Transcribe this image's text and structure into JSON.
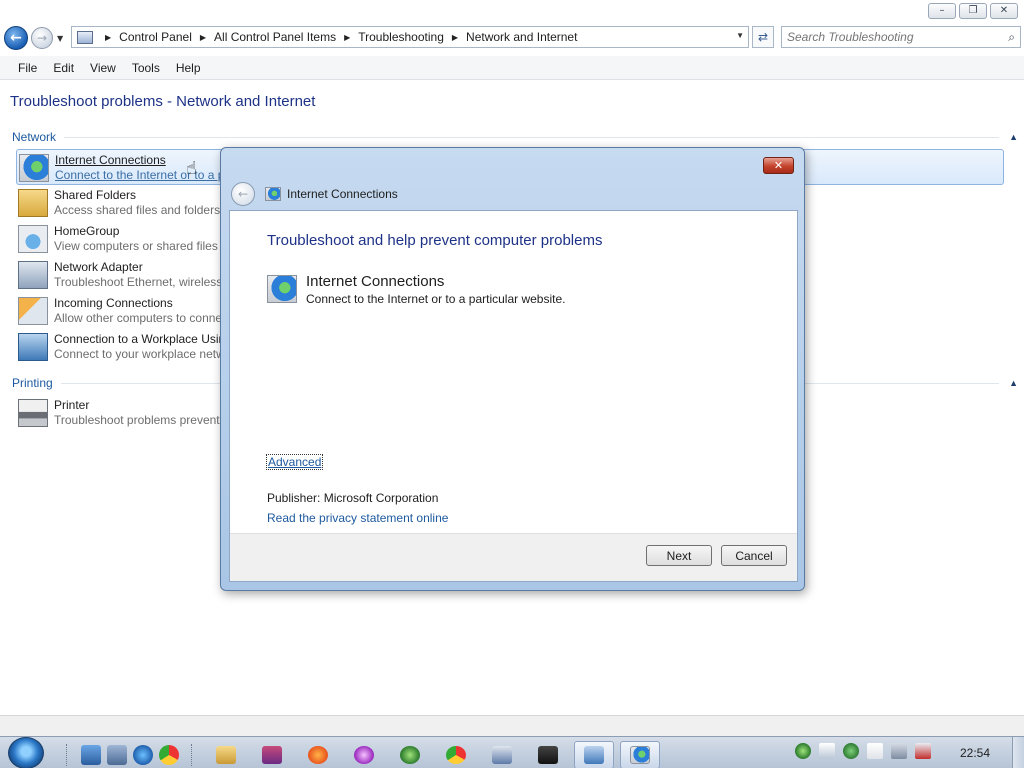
{
  "window": {
    "buttons": {
      "minimize": "–",
      "maximize": "❐",
      "close": "✕"
    }
  },
  "address": {
    "breadcrumbs": [
      "Control Panel",
      "All Control Panel Items",
      "Troubleshooting",
      "Network and Internet"
    ],
    "search_placeholder": "Search Troubleshooting"
  },
  "menu": [
    "File",
    "Edit",
    "View",
    "Tools",
    "Help"
  ],
  "main": {
    "title": "Troubleshoot problems - Network and Internet",
    "groups": [
      {
        "label": "Network",
        "items": [
          {
            "name": "Internet Connections",
            "desc": "Connect to the Internet or to a particular website.",
            "icon": "globe-icon",
            "selected": true
          },
          {
            "name": "Shared Folders",
            "desc": "Access shared files and folders on other computers.",
            "icon": "shared-folder-icon"
          },
          {
            "name": "HomeGroup",
            "desc": "View computers or shared files in a homegroup.",
            "icon": "homegroup-icon"
          },
          {
            "name": "Network Adapter",
            "desc": "Troubleshoot Ethernet, wireless, and other network adapters.",
            "icon": "network-adapter-icon"
          },
          {
            "name": "Incoming Connections",
            "desc": "Allow other computers to connect to your computer.",
            "icon": "incoming-connections-icon"
          },
          {
            "name": "Connection to a Workplace Using DirectAccess",
            "desc": "Connect to your workplace network over the Internet.",
            "icon": "workplace-icon"
          }
        ]
      },
      {
        "label": "Printing",
        "items": [
          {
            "name": "Printer",
            "desc": "Troubleshoot problems preventing printing from completing.",
            "icon": "printer-icon"
          }
        ]
      }
    ]
  },
  "dialog": {
    "title": "Internet Connections",
    "heading": "Troubleshoot and help prevent computer problems",
    "item_name": "Internet Connections",
    "item_desc": "Connect to the Internet or to a particular website.",
    "advanced": "Advanced",
    "publisher": "Publisher:  Microsoft Corporation",
    "privacy": "Read the privacy statement online",
    "next": "Next",
    "cancel": "Cancel",
    "close": "✕"
  },
  "taskbar": {
    "clock": "22:54"
  },
  "colors": {
    "link": "#1e5aa0",
    "heading": "#1e3287",
    "selection": "#d9e9fb"
  }
}
